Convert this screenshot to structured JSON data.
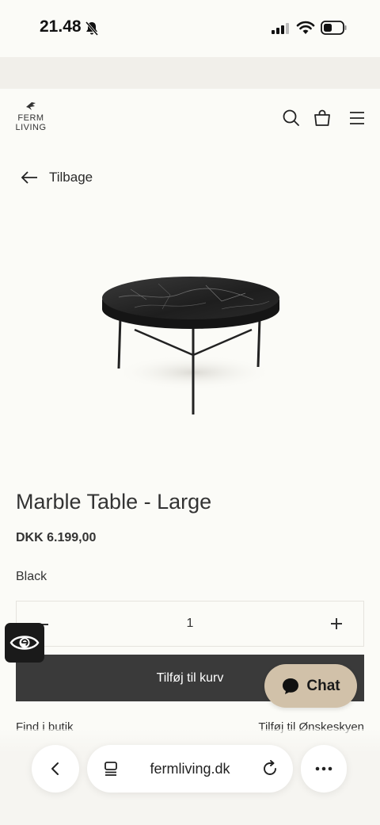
{
  "status_bar": {
    "time": "21.48",
    "icons": [
      "bell-slash-icon",
      "cellular-signal-icon",
      "wifi-icon",
      "battery-icon"
    ]
  },
  "header": {
    "logo_line1": "FERM",
    "logo_line2": "LIVING",
    "icons": [
      "search-icon",
      "shopping-bag-icon",
      "menu-icon"
    ]
  },
  "nav": {
    "back_label": "Tilbage"
  },
  "product": {
    "title": "Marble Table - Large",
    "price": "DKK 6.199,00",
    "color_name": "Black",
    "quantity": "1",
    "add_to_cart_label": "Tilføj til kurv",
    "find_in_store_label": "Find i butik",
    "add_to_wishlist_label": "Tilføj til Ønskeskyen"
  },
  "chat": {
    "label": "Chat"
  },
  "browser": {
    "url": "fermliving.dk",
    "icons": [
      "chevron-left-icon",
      "tabs-icon",
      "reload-icon",
      "more-icon"
    ]
  },
  "colors": {
    "page_bg": "#fbfbf7",
    "button_dark": "#3a3a3a",
    "chat_bg": "#d1c1a9",
    "banner_bg": "#f1efea"
  }
}
